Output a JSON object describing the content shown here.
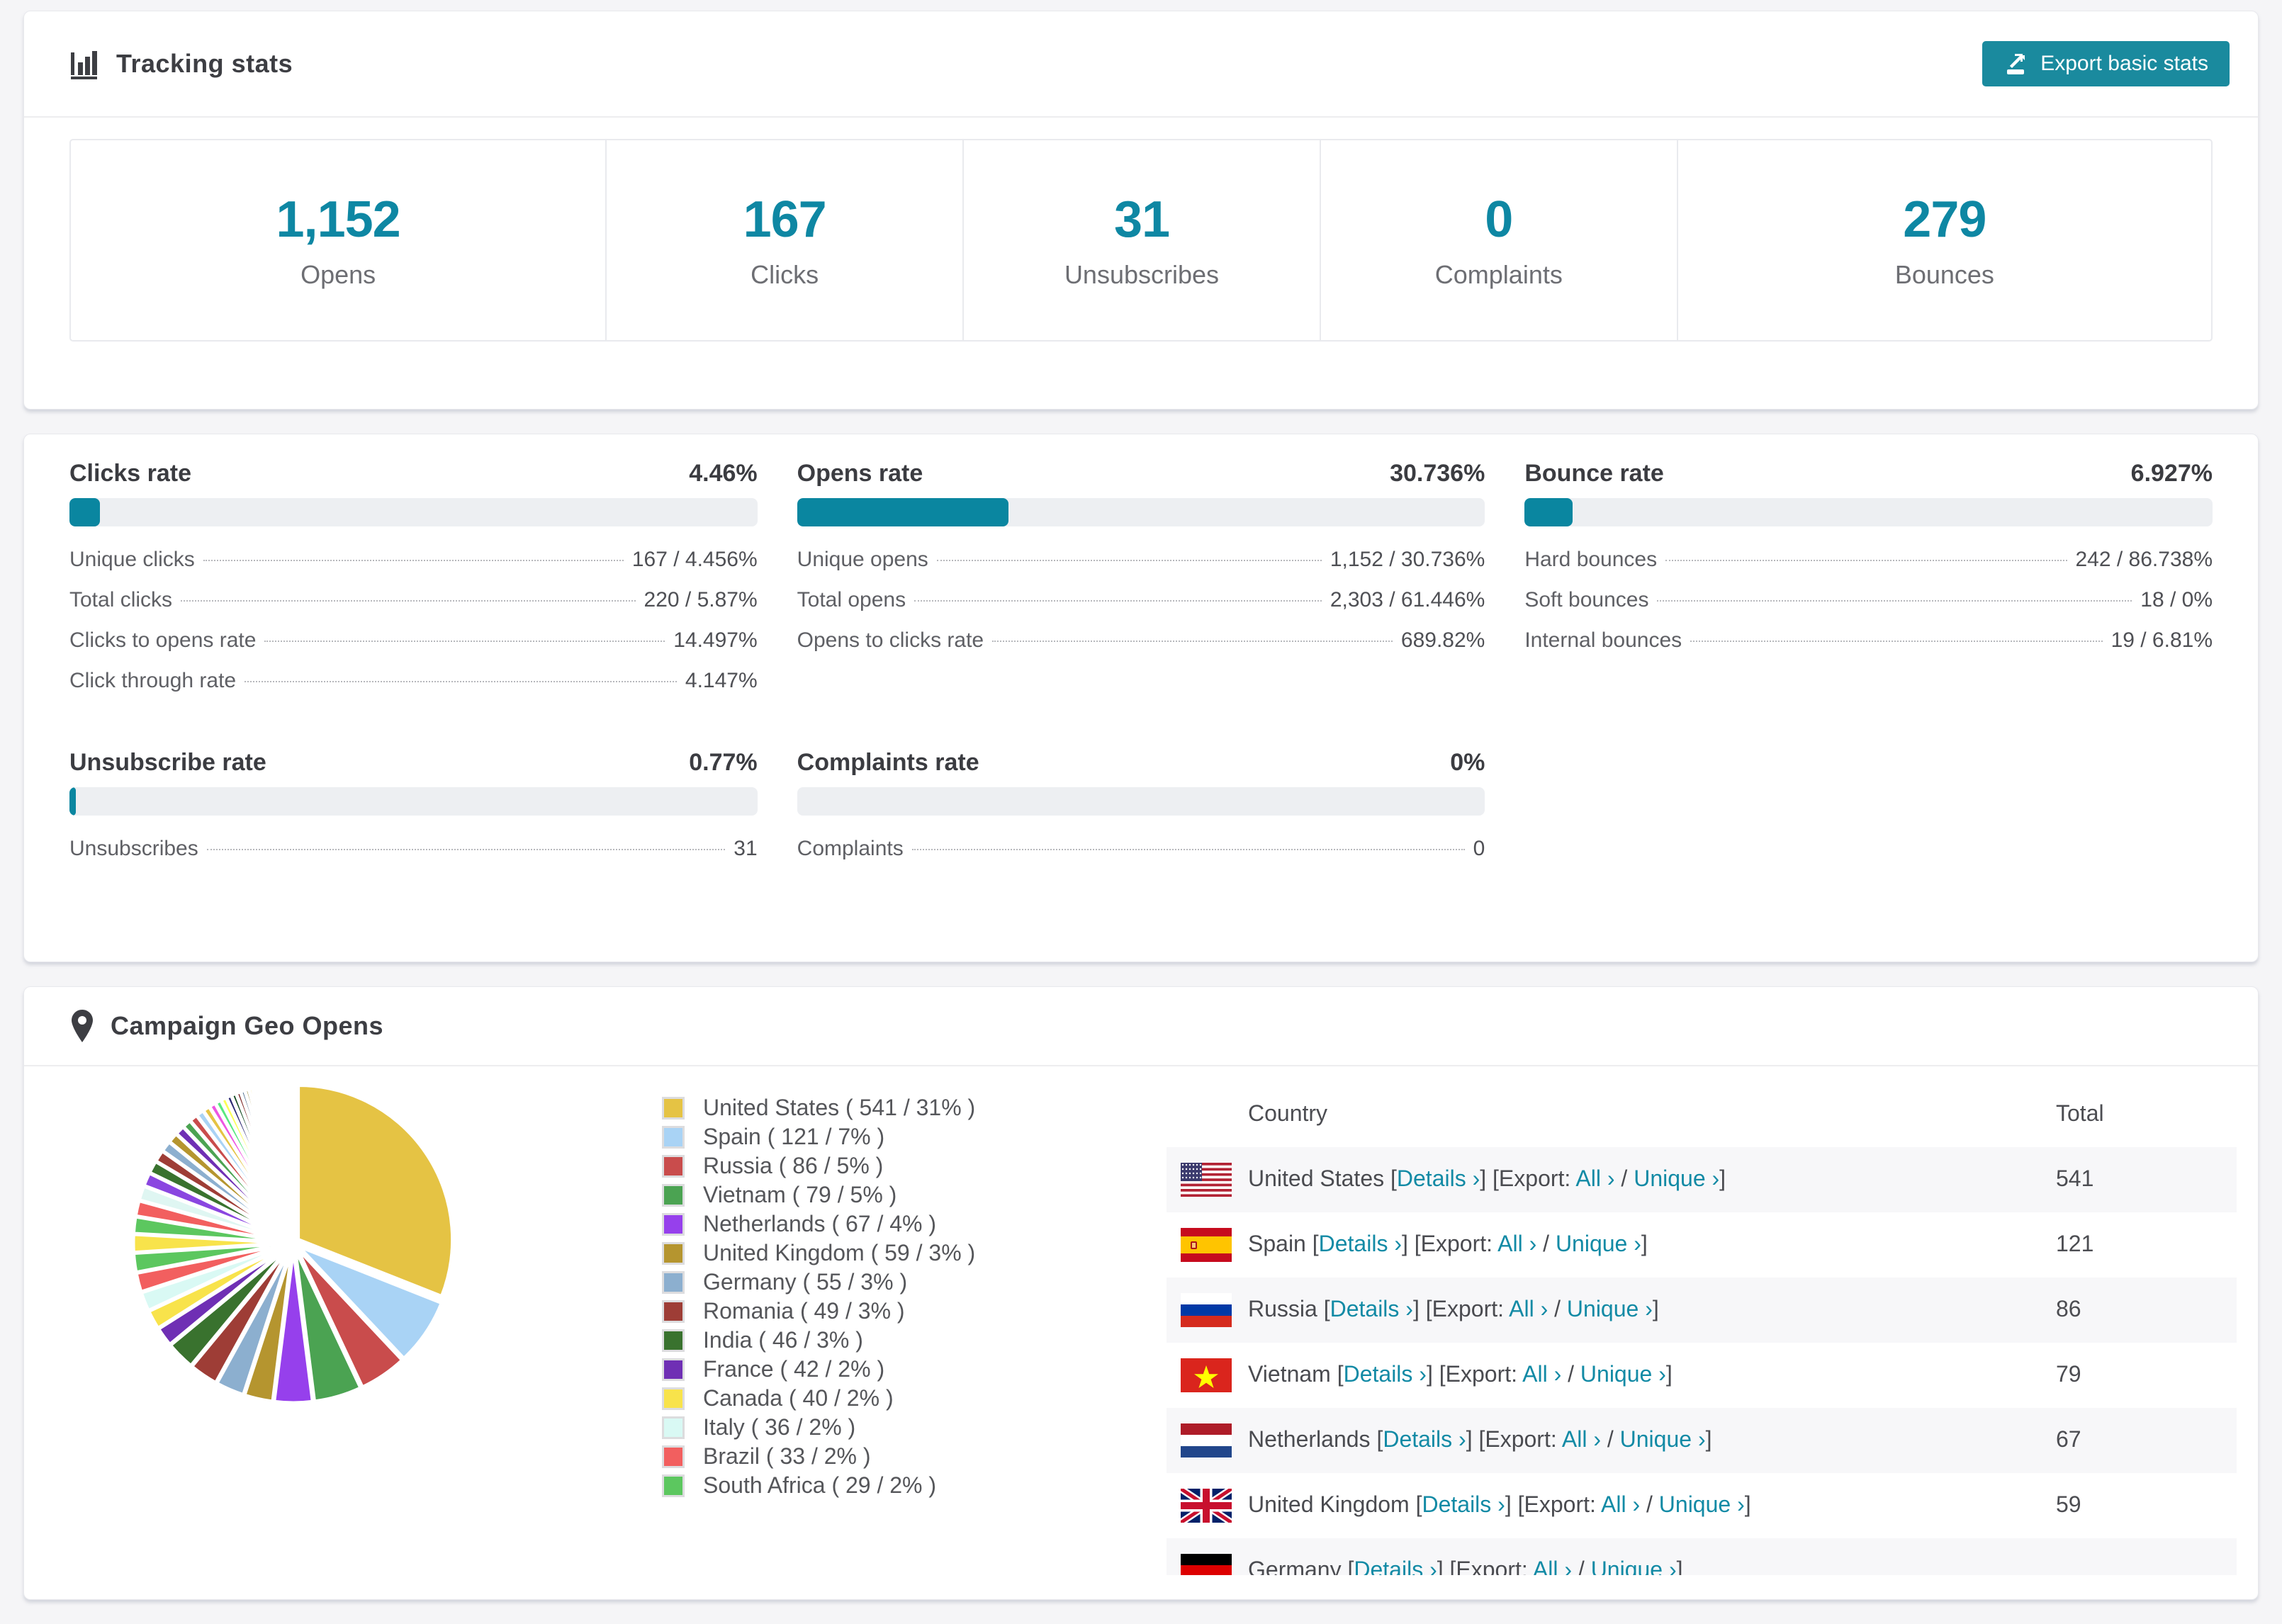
{
  "accent": {
    "teal_button": "#1a8a9e",
    "teal_text": "#0e87a3",
    "bar_fill": "#0a86a0",
    "bar_track": "#edeff2"
  },
  "tracking": {
    "title": "Tracking stats",
    "export_button": "Export basic stats",
    "stats": [
      {
        "value": "1,152",
        "label": "Opens"
      },
      {
        "value": "167",
        "label": "Clicks"
      },
      {
        "value": "31",
        "label": "Unsubscribes"
      },
      {
        "value": "0",
        "label": "Complaints"
      },
      {
        "value": "279",
        "label": "Bounces"
      }
    ]
  },
  "rates": {
    "blocks": [
      {
        "title": "Clicks rate",
        "value": "4.46%",
        "percent": 4.46,
        "rows": [
          {
            "label": "Unique clicks",
            "value": "167 / 4.456%"
          },
          {
            "label": "Total clicks",
            "value": "220 / 5.87%"
          },
          {
            "label": "Clicks to opens rate",
            "value": "14.497%"
          },
          {
            "label": "Click through rate",
            "value": "4.147%"
          }
        ]
      },
      {
        "title": "Opens rate",
        "value": "30.736%",
        "percent": 30.736,
        "rows": [
          {
            "label": "Unique opens",
            "value": "1,152 / 30.736%"
          },
          {
            "label": "Total opens",
            "value": "2,303 / 61.446%"
          },
          {
            "label": "Opens to clicks rate",
            "value": "689.82%"
          }
        ]
      },
      {
        "title": "Bounce rate",
        "value": "6.927%",
        "percent": 6.927,
        "rows": [
          {
            "label": "Hard bounces",
            "value": "242 / 86.738%"
          },
          {
            "label": "Soft bounces",
            "value": "18 / 0%"
          },
          {
            "label": "Internal bounces",
            "value": "19 / 6.81%"
          }
        ]
      },
      {
        "title": "Unsubscribe rate",
        "value": "0.77%",
        "percent": 0.77,
        "rows": [
          {
            "label": "Unsubscribes",
            "value": "31"
          }
        ]
      },
      {
        "title": "Complaints rate",
        "value": "0%",
        "percent": 0,
        "rows": [
          {
            "label": "Complaints",
            "value": "0"
          }
        ]
      }
    ]
  },
  "geo": {
    "title": "Campaign Geo Opens",
    "table": {
      "headers": [
        "Country",
        "Total"
      ],
      "links": {
        "details": "Details ›",
        "export_prefix": "Export:",
        "all": "All ›",
        "unique": "Unique ›"
      },
      "punct": {
        "open": "[",
        "close": "]",
        "slash": "/"
      },
      "rows": [
        {
          "country": "United States",
          "flag": "us",
          "total": "541",
          "partial": false
        },
        {
          "country": "Spain",
          "flag": "es",
          "total": "121",
          "partial": false
        },
        {
          "country": "Russia",
          "flag": "ru",
          "total": "86",
          "partial": false
        },
        {
          "country": "Vietnam",
          "flag": "vn",
          "total": "79",
          "partial": false
        },
        {
          "country": "Netherlands",
          "flag": "nl",
          "total": "67",
          "partial": false
        },
        {
          "country": "United Kingdom",
          "flag": "gb",
          "total": "59",
          "partial": false
        },
        {
          "country": "Germany",
          "flag": "de",
          "total": "",
          "partial": true
        }
      ]
    }
  },
  "chart_data": {
    "type": "pie",
    "title": "Campaign Geo Opens",
    "unit": "opens",
    "start_angle_deg": -90,
    "direction": "clockwise",
    "slices": [
      {
        "label": "United States",
        "value": 541,
        "pct": 31,
        "color": "#e5c344"
      },
      {
        "label": "Spain",
        "value": 121,
        "pct": 7,
        "color": "#a9d3f5"
      },
      {
        "label": "Russia",
        "value": 86,
        "pct": 5,
        "color": "#c94c4c"
      },
      {
        "label": "Vietnam",
        "value": 79,
        "pct": 5,
        "color": "#4ba352"
      },
      {
        "label": "Netherlands",
        "value": 67,
        "pct": 4,
        "color": "#9640ec"
      },
      {
        "label": "United Kingdom",
        "value": 59,
        "pct": 3,
        "color": "#b5952f"
      },
      {
        "label": "Germany",
        "value": 55,
        "pct": 3,
        "color": "#8cafcf"
      },
      {
        "label": "Romania",
        "value": 49,
        "pct": 3,
        "color": "#9e3d36"
      },
      {
        "label": "India",
        "value": 46,
        "pct": 3,
        "color": "#39722e"
      },
      {
        "label": "France",
        "value": 42,
        "pct": 2,
        "color": "#6f2fb4"
      },
      {
        "label": "Canada",
        "value": 40,
        "pct": 2,
        "color": "#f8e34b"
      },
      {
        "label": "Italy",
        "value": 36,
        "pct": 2,
        "color": "#d9f9f4"
      },
      {
        "label": "Brazil",
        "value": 33,
        "pct": 2,
        "color": "#f25f5f"
      },
      {
        "label": "South Africa",
        "value": 29,
        "pct": 2,
        "color": "#5cc75f"
      }
    ],
    "legend_format": "{label} ( {value} / {pct}% )",
    "tail": {
      "pct_total": 26,
      "slice_count": 46,
      "decay": 0.93,
      "palette": [
        "#f8e34b",
        "#5cc75f",
        "#f25f5f",
        "#dff6f2",
        "#8a46e0",
        "#39722e",
        "#9e3d36",
        "#8cafcf",
        "#b5952f",
        "#6f2fb4",
        "#4ba352",
        "#c94c4c",
        "#a9d3f5",
        "#e5c344",
        "#ee55e2",
        "#58e87e",
        "#fbff55",
        "#2c2a72",
        "#12491f",
        "#7c2424",
        "#4f6f8f",
        "#8c7c22"
      ]
    }
  }
}
